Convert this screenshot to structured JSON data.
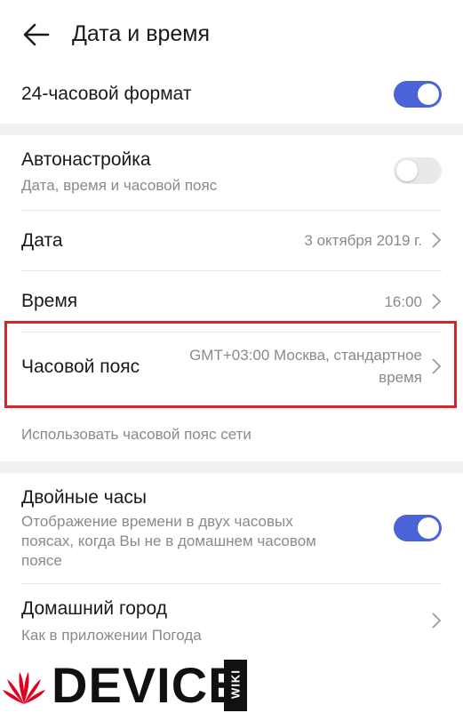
{
  "header": {
    "title": "Дата и время"
  },
  "format24": {
    "label": "24-часовой формат",
    "enabled": true
  },
  "auto": {
    "title": "Автонастройка",
    "subtitle": "Дата, время и часовой пояс",
    "enabled": false
  },
  "date": {
    "title": "Дата",
    "value": "3 октября 2019 г."
  },
  "time": {
    "title": "Время",
    "value": "16:00"
  },
  "timezone": {
    "title": "Часовой пояс",
    "value_line1": "GMT+03:00 Москва, стандартное",
    "value_line2": "время"
  },
  "network_tz": {
    "label": "Использовать часовой пояс сети"
  },
  "dual_clock": {
    "title": "Двойные часы",
    "subtitle_line1": "Отображение времени в двух часовых",
    "subtitle_line2": "поясах, когда Вы не в домашнем часовом",
    "subtitle_line3": "поясе",
    "enabled": true
  },
  "home_city": {
    "title": "Домашний город",
    "subtitle": "Как в приложении Погода"
  },
  "watermark": {
    "text": "DEVICE",
    "badge": "WIKI"
  },
  "colors": {
    "accent": "#4a63d8",
    "highlight": "#d9232a",
    "brand_red": "#e1001e"
  }
}
